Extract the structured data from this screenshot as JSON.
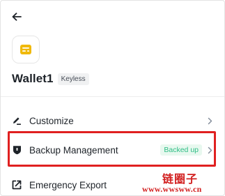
{
  "header": {
    "back_icon": "arrow-left-icon"
  },
  "wallet": {
    "logo_icon": "wallet-card-icon",
    "logo_color": "#f0b90b",
    "name": "Wallet1",
    "badge": "Keyless"
  },
  "menu": {
    "items": [
      {
        "label": "Customize",
        "icon": "pen-icon",
        "status": ""
      },
      {
        "label": "Backup Management",
        "icon": "shield-icon",
        "status": "Backed up"
      },
      {
        "label": "Emergency Export",
        "icon": "export-icon",
        "status": ""
      }
    ]
  },
  "highlight_color": "#e02020",
  "watermark": {
    "text": "链圈子",
    "url": "www.wwsww.cn"
  }
}
